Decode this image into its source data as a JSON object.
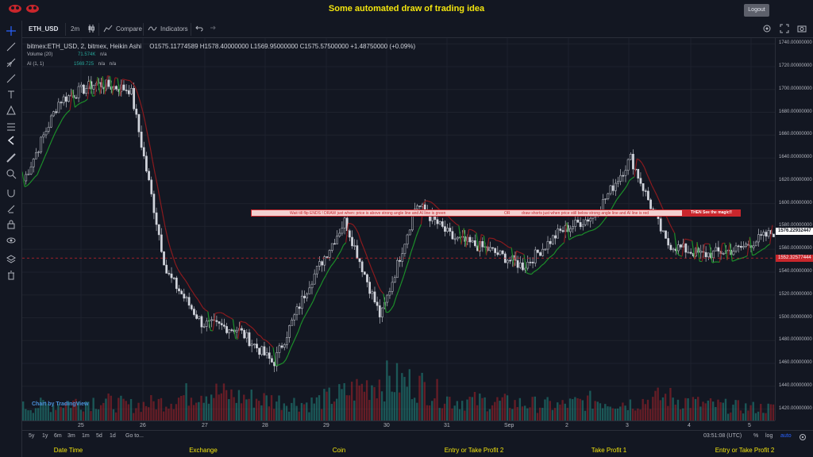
{
  "header": {
    "title": "Some automated draw of trading idea",
    "logout_label": "Logout"
  },
  "toolbar": {
    "symbol": "ETH_USD",
    "interval": "2m",
    "compare_label": "Compare",
    "indicators_label": "Indicators"
  },
  "legend": {
    "main": "bitmex:ETH_USD, 2, bitmex, Heikin Ashi",
    "ohlc": "O1575.11774589  H1578.40000000  L1569.95000000  C1575.57500000  +1.48750000 (+0.09%)",
    "volume_label": "Volume (20)",
    "volume_value": "71.574K",
    "volume_na": "n/a",
    "ai_label": "AI (1, 1)",
    "ai_value": "1569.725",
    "ai_na1": "n/a",
    "ai_na2": "n/a"
  },
  "price_axis": {
    "labels": [
      "1740.00000000",
      "1720.00000000",
      "1700.00000000",
      "1680.00000000",
      "1660.00000000",
      "1640.00000000",
      "1620.00000000",
      "1600.00000000",
      "1580.00000000",
      "1560.00000000",
      "1540.00000000",
      "1520.00000000",
      "1500.00000000",
      "1480.00000000",
      "1460.00000000",
      "1440.00000000",
      "1420.00000000"
    ],
    "last_price": "1576.22932447",
    "marked_price": "1552.32577444"
  },
  "time_axis": {
    "labels": [
      "25",
      "26",
      "27",
      "28",
      "29",
      "30",
      "31",
      "Sep",
      "2",
      "3",
      "4",
      "5"
    ]
  },
  "drawing": {
    "text1": "Wait till flip ENDS  !   DRAW just when:  price is above strong angle line and AI line is green",
    "text2": "OR",
    "text3": "draw shorts just when price still below strong angle line and AI line is red",
    "magic": "THEN See the magic!!"
  },
  "watermark": "Chart by TradingView",
  "bottom": {
    "ranges": [
      "5y",
      "1y",
      "6m",
      "3m",
      "1m",
      "5d",
      "1d"
    ],
    "goto": "Go to...",
    "time": "03:51:08 (UTC)",
    "percent": "%",
    "log": "log",
    "auto": "auto"
  },
  "footer": {
    "labels": [
      "Date Time",
      "Exchange",
      "Coin",
      "Entry or Take Profit 2",
      "Take Profit 1",
      "Entry or Take Profit 2"
    ]
  },
  "colors": {
    "background": "#131722",
    "accent_yellow": "#f3e50e",
    "bull": "#26a69a",
    "bear": "#c9262c"
  },
  "chart_data": {
    "type": "line",
    "title": "",
    "xlabel": "",
    "ylabel": "",
    "categories": [
      "25",
      "26",
      "27",
      "28",
      "29",
      "30",
      "31",
      "Sep",
      "2",
      "3",
      "4",
      "5"
    ],
    "ylim": [
      1410,
      1745
    ],
    "series": [
      {
        "name": "",
        "values": [
          1620,
          1690,
          1705,
          1700,
          1540,
          1495,
          1490,
          1460,
          1530,
          1585,
          1500,
          1600,
          1570,
          1560,
          1545,
          1575,
          1590,
          1640,
          1565,
          1555,
          1560,
          1575
        ]
      }
    ],
    "volume": [
      20,
      25,
      30,
      22,
      28,
      45,
      35,
      30,
      25,
      40,
      60,
      55,
      30,
      28,
      25,
      22,
      30,
      26,
      35,
      24,
      20,
      18
    ],
    "reference_line": 1552.33
  }
}
